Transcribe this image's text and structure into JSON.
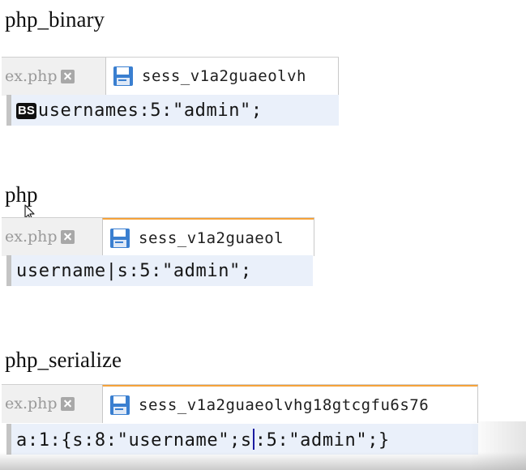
{
  "sections": [
    {
      "title": "php_binary",
      "tab_inactive_label": "ex.php",
      "tab_active_label": "sess_v1a2guaeolvh",
      "code_badge": "BS",
      "code_text": "usernames:5:\"admin\";"
    },
    {
      "title": "php",
      "tab_inactive_label": "ex.php",
      "tab_active_label": "sess_v1a2guaeol",
      "code_text": "username|s:5:\"admin\";"
    },
    {
      "title": "php_serialize",
      "tab_inactive_label": "ex.php",
      "tab_active_label": "sess_v1a2guaeolvhg18gtcgfu6s76",
      "code_before_caret": "a:1:{s:8:\"username\";s",
      "code_after_caret": ":5:\"admin\";}"
    }
  ],
  "colors": {
    "active_tab_accent": "#f5a23a",
    "editor_line_bg": "#eaf0fa",
    "save_icon": "#3a7fd0"
  },
  "icons": {
    "tab_close": "close-icon",
    "file_save": "save-icon",
    "mouse_pointer": "cursor-icon"
  }
}
